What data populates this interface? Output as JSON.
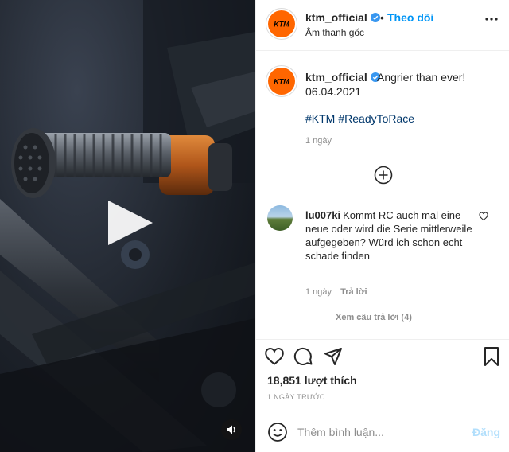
{
  "colors": {
    "accent": "#0095f6",
    "brand": "#ff6600",
    "muted": "#8e8e8e",
    "post_disabled": "#b2dffc"
  },
  "header": {
    "username": "ktm_official",
    "dot": "•",
    "follow_label": "Theo dõi",
    "audio_label": "Âm thanh gốc",
    "logo_text": "KTM"
  },
  "caption": {
    "username": "ktm_official",
    "text": "Angrier than ever!",
    "date": "06.04.2021",
    "hashtags": [
      "#KTM",
      "#ReadyToRace"
    ],
    "time": "1 ngày"
  },
  "comment": {
    "username": "lu007ki",
    "text": "Kommt RC auch mal eine neue oder wird die Serie mittlerweile aufgegeben? Würd ich schon echt schade finden",
    "time": "1 ngày",
    "reply_label": "Trả lời",
    "view_replies": "Xem câu trả lời (4)"
  },
  "actions": {
    "likes": "18,851 lượt thích",
    "posted": "1 NGÀY TRƯỚC",
    "icons": [
      "heart-icon",
      "comment-icon",
      "share-icon",
      "bookmark-icon"
    ]
  },
  "composer": {
    "placeholder": "Thêm bình luận...",
    "post_label": "Đăng"
  },
  "media": {
    "icons": [
      "play-icon",
      "sound-icon"
    ]
  }
}
